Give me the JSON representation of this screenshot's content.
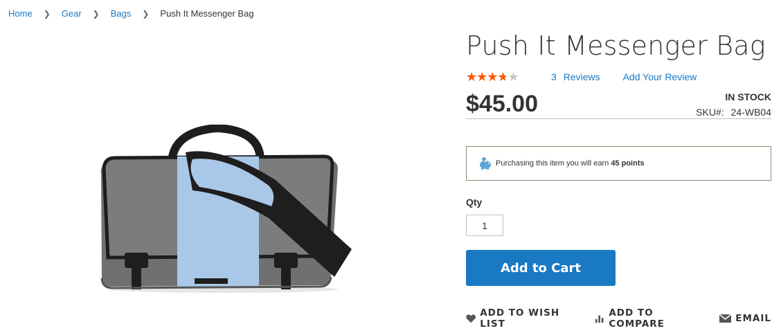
{
  "breadcrumb": {
    "items": [
      "Home",
      "Gear",
      "Bags"
    ],
    "current": "Push It Messenger Bag",
    "separator": ">"
  },
  "product": {
    "title": "Push It Messenger Bag",
    "rating_fraction": 0.65,
    "review_count": "3",
    "reviews_label": "Reviews",
    "add_review_label": "Add Your Review",
    "price": "$45.00",
    "stock": "IN STOCK",
    "sku_label": "SKU#:",
    "sku": "24-WB04",
    "image_alt": "messenger-bag",
    "colors": {
      "body": "#707070",
      "panel": "#a9c8e8",
      "strap": "#1e1e1e"
    }
  },
  "rewards": {
    "text_prefix": "Purchasing this item you will earn",
    "points": "45 points",
    "icon": "piggy-bank-icon",
    "icon_color": "#5aa7d8"
  },
  "purchase": {
    "qty_label": "Qty",
    "qty_value": "1",
    "add_to_cart_label": "Add to Cart",
    "button_color": "#1979c3"
  },
  "actions": {
    "wishlist": "Add to Wish List",
    "compare": "Add to Compare",
    "email": "Email"
  }
}
